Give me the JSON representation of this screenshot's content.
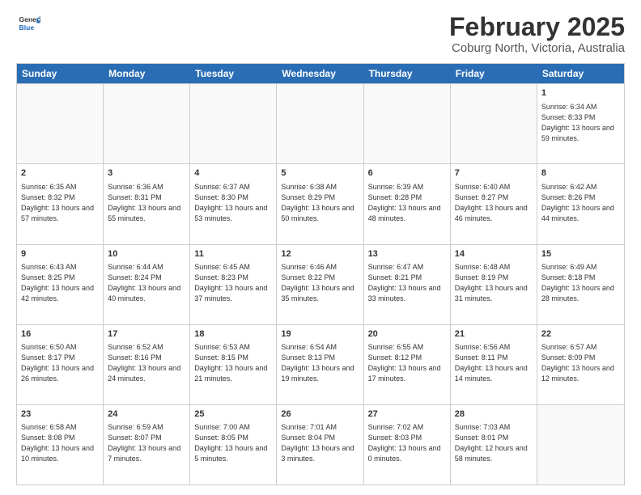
{
  "header": {
    "logo_line1": "General",
    "logo_line2": "Blue",
    "title": "February 2025",
    "subtitle": "Coburg North, Victoria, Australia"
  },
  "days": [
    "Sunday",
    "Monday",
    "Tuesday",
    "Wednesday",
    "Thursday",
    "Friday",
    "Saturday"
  ],
  "weeks": [
    [
      {
        "num": "",
        "text": "",
        "empty": true
      },
      {
        "num": "",
        "text": "",
        "empty": true
      },
      {
        "num": "",
        "text": "",
        "empty": true
      },
      {
        "num": "",
        "text": "",
        "empty": true
      },
      {
        "num": "",
        "text": "",
        "empty": true
      },
      {
        "num": "",
        "text": "",
        "empty": true
      },
      {
        "num": "1",
        "text": "Sunrise: 6:34 AM\nSunset: 8:33 PM\nDaylight: 13 hours and 59 minutes.",
        "empty": false
      }
    ],
    [
      {
        "num": "2",
        "text": "Sunrise: 6:35 AM\nSunset: 8:32 PM\nDaylight: 13 hours and 57 minutes.",
        "empty": false
      },
      {
        "num": "3",
        "text": "Sunrise: 6:36 AM\nSunset: 8:31 PM\nDaylight: 13 hours and 55 minutes.",
        "empty": false
      },
      {
        "num": "4",
        "text": "Sunrise: 6:37 AM\nSunset: 8:30 PM\nDaylight: 13 hours and 53 minutes.",
        "empty": false
      },
      {
        "num": "5",
        "text": "Sunrise: 6:38 AM\nSunset: 8:29 PM\nDaylight: 13 hours and 50 minutes.",
        "empty": false
      },
      {
        "num": "6",
        "text": "Sunrise: 6:39 AM\nSunset: 8:28 PM\nDaylight: 13 hours and 48 minutes.",
        "empty": false
      },
      {
        "num": "7",
        "text": "Sunrise: 6:40 AM\nSunset: 8:27 PM\nDaylight: 13 hours and 46 minutes.",
        "empty": false
      },
      {
        "num": "8",
        "text": "Sunrise: 6:42 AM\nSunset: 8:26 PM\nDaylight: 13 hours and 44 minutes.",
        "empty": false
      }
    ],
    [
      {
        "num": "9",
        "text": "Sunrise: 6:43 AM\nSunset: 8:25 PM\nDaylight: 13 hours and 42 minutes.",
        "empty": false
      },
      {
        "num": "10",
        "text": "Sunrise: 6:44 AM\nSunset: 8:24 PM\nDaylight: 13 hours and 40 minutes.",
        "empty": false
      },
      {
        "num": "11",
        "text": "Sunrise: 6:45 AM\nSunset: 8:23 PM\nDaylight: 13 hours and 37 minutes.",
        "empty": false
      },
      {
        "num": "12",
        "text": "Sunrise: 6:46 AM\nSunset: 8:22 PM\nDaylight: 13 hours and 35 minutes.",
        "empty": false
      },
      {
        "num": "13",
        "text": "Sunrise: 6:47 AM\nSunset: 8:21 PM\nDaylight: 13 hours and 33 minutes.",
        "empty": false
      },
      {
        "num": "14",
        "text": "Sunrise: 6:48 AM\nSunset: 8:19 PM\nDaylight: 13 hours and 31 minutes.",
        "empty": false
      },
      {
        "num": "15",
        "text": "Sunrise: 6:49 AM\nSunset: 8:18 PM\nDaylight: 13 hours and 28 minutes.",
        "empty": false
      }
    ],
    [
      {
        "num": "16",
        "text": "Sunrise: 6:50 AM\nSunset: 8:17 PM\nDaylight: 13 hours and 26 minutes.",
        "empty": false
      },
      {
        "num": "17",
        "text": "Sunrise: 6:52 AM\nSunset: 8:16 PM\nDaylight: 13 hours and 24 minutes.",
        "empty": false
      },
      {
        "num": "18",
        "text": "Sunrise: 6:53 AM\nSunset: 8:15 PM\nDaylight: 13 hours and 21 minutes.",
        "empty": false
      },
      {
        "num": "19",
        "text": "Sunrise: 6:54 AM\nSunset: 8:13 PM\nDaylight: 13 hours and 19 minutes.",
        "empty": false
      },
      {
        "num": "20",
        "text": "Sunrise: 6:55 AM\nSunset: 8:12 PM\nDaylight: 13 hours and 17 minutes.",
        "empty": false
      },
      {
        "num": "21",
        "text": "Sunrise: 6:56 AM\nSunset: 8:11 PM\nDaylight: 13 hours and 14 minutes.",
        "empty": false
      },
      {
        "num": "22",
        "text": "Sunrise: 6:57 AM\nSunset: 8:09 PM\nDaylight: 13 hours and 12 minutes.",
        "empty": false
      }
    ],
    [
      {
        "num": "23",
        "text": "Sunrise: 6:58 AM\nSunset: 8:08 PM\nDaylight: 13 hours and 10 minutes.",
        "empty": false
      },
      {
        "num": "24",
        "text": "Sunrise: 6:59 AM\nSunset: 8:07 PM\nDaylight: 13 hours and 7 minutes.",
        "empty": false
      },
      {
        "num": "25",
        "text": "Sunrise: 7:00 AM\nSunset: 8:05 PM\nDaylight: 13 hours and 5 minutes.",
        "empty": false
      },
      {
        "num": "26",
        "text": "Sunrise: 7:01 AM\nSunset: 8:04 PM\nDaylight: 13 hours and 3 minutes.",
        "empty": false
      },
      {
        "num": "27",
        "text": "Sunrise: 7:02 AM\nSunset: 8:03 PM\nDaylight: 13 hours and 0 minutes.",
        "empty": false
      },
      {
        "num": "28",
        "text": "Sunrise: 7:03 AM\nSunset: 8:01 PM\nDaylight: 12 hours and 58 minutes.",
        "empty": false
      },
      {
        "num": "",
        "text": "",
        "empty": true
      }
    ]
  ]
}
